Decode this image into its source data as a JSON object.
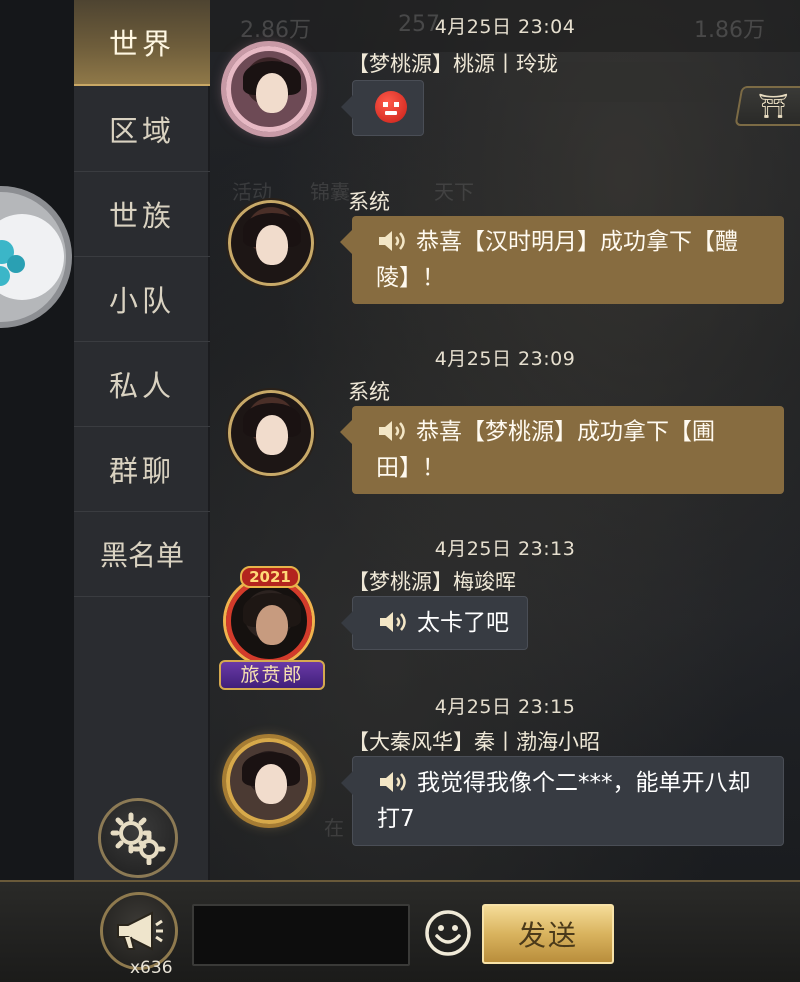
{
  "sidebar": {
    "tabs": [
      {
        "label": "世界"
      },
      {
        "label": "区域"
      },
      {
        "label": "世族"
      },
      {
        "label": "小队"
      },
      {
        "label": "私人"
      },
      {
        "label": "群聊"
      },
      {
        "label": "黑名单"
      }
    ],
    "active_index": 0
  },
  "background": {
    "res_1": "2.86万",
    "res_2": "257",
    "res_3": "1.86万",
    "tab_activity": "活动",
    "tab_brocade": "锦囊",
    "tab_world": "天下",
    "hint_text": "在"
  },
  "messages": [
    {
      "time": "4月25日 23:04",
      "sender": "【梦桃源】桃源丨玲珑",
      "text": "",
      "emoji": "angry-red-face",
      "style": "gray"
    },
    {
      "time": "",
      "sender": "系统",
      "text": "恭喜【汉时明月】成功拿下【醴陵】！",
      "style": "gold"
    },
    {
      "time": "4月25日 23:09",
      "sender": "系统",
      "text": "恭喜【梦桃源】成功拿下【圃田】！",
      "style": "gold"
    },
    {
      "time": "4月25日 23:13",
      "sender": "【梦桃源】梅竣晖",
      "text": "太卡了吧",
      "badge": "2021",
      "title_plate": "旅贲郎",
      "style": "gray"
    },
    {
      "time": "4月25日 23:15",
      "sender": "【大秦风华】秦丨渤海小昭",
      "text": "我觉得我像个二***，能单开八却打7",
      "style": "gray"
    }
  ],
  "bottom_bar": {
    "horn_count": "x636",
    "input_placeholder": "",
    "send_label": "发送"
  },
  "colors": {
    "gold_bubble": "#876c40",
    "gray_bubble": "#373b42",
    "active_tab": "#8f7848",
    "send_button": "#d9b35e"
  }
}
